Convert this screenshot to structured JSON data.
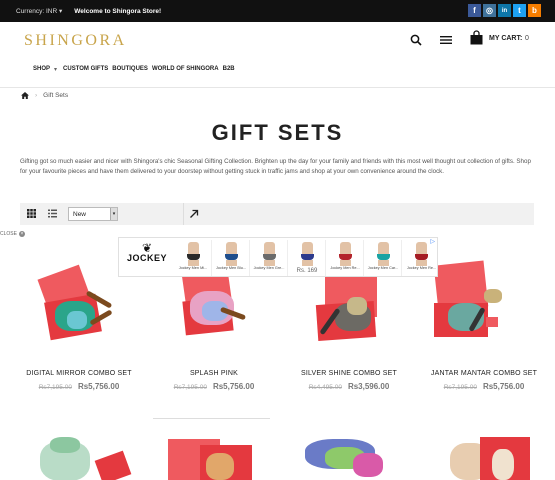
{
  "topbar": {
    "currency_label": "Currency: INR",
    "welcome": "Welcome to Shingora Store!",
    "social": [
      {
        "icon": "facebook-icon",
        "glyph": "f",
        "color": "#3b5998"
      },
      {
        "icon": "instagram-icon",
        "glyph": "◎",
        "color": "#3f729b"
      },
      {
        "icon": "linkedin-icon",
        "glyph": "in",
        "color": "#0e76a8"
      },
      {
        "icon": "twitter-icon",
        "glyph": "t",
        "color": "#1da1f2"
      },
      {
        "icon": "blog-icon",
        "glyph": "b",
        "color": "#f57d00"
      }
    ]
  },
  "header": {
    "logo": "SHINGORA",
    "cart_label": "MY CART:",
    "cart_count": "0",
    "nav": [
      "SHOP",
      "CUSTOM GIFTS",
      "BOUTIQUES",
      "WORLD OF SHINGORA",
      "B2B"
    ]
  },
  "breadcrumb": {
    "current": "Gift Sets"
  },
  "page": {
    "title": "GIFT SETS",
    "intro": "Gifting got so much easier and nicer with Shingora's chic Seasonal Gifting Collection. Brighten up the day for your family and friends with this most well thought out collection of gifts. Shop for your favourite pieces and have them delivered to your doorstep without getting stuck in traffic jams and shop at your own convenience around the clock."
  },
  "toolbar": {
    "sort_value": "New"
  },
  "ad": {
    "close_label": "CLOSE",
    "brand": "JOCKEY",
    "items": [
      {
        "caption": "Jockey Men Mi...",
        "price": "",
        "brief_color": "#2a2a2a"
      },
      {
        "caption": "Jockey Men Blu...",
        "price": "",
        "brief_color": "#1f4e8c"
      },
      {
        "caption": "Jockey Men Gre...",
        "price": "",
        "brief_color": "#6b6b6b"
      },
      {
        "caption": "",
        "price": "Rs. 169",
        "brief_color": "#2d3a8c"
      },
      {
        "caption": "Jockey Men Re...",
        "price": "",
        "brief_color": "#b3232b"
      },
      {
        "caption": "Jockey Men Car...",
        "price": "",
        "brief_color": "#1aa3a3"
      },
      {
        "caption": "Jockey Men Re...",
        "price": "",
        "brief_color": "#a51c24"
      }
    ]
  },
  "products": [
    {
      "name": "DIGITAL MIRROR COMBO SET",
      "old_price": "Rs7,195.00",
      "new_price": "Rs5,756.00"
    },
    {
      "name": "SPLASH PINK",
      "old_price": "Rs7,195.00",
      "new_price": "Rs5,756.00"
    },
    {
      "name": "SILVER SHINE COMBO SET",
      "old_price": "Rs4,495.00",
      "new_price": "Rs3,596.00"
    },
    {
      "name": "JANTAR MANTAR COMBO SET",
      "old_price": "Rs7,195.00",
      "new_price": "Rs5,756.00"
    }
  ],
  "colors": {
    "topbar_bg": "#111111",
    "logo_gold": "#c8a44a",
    "gift_box_red": "#e4393f",
    "toolbar_bg": "#f1f1f1"
  }
}
